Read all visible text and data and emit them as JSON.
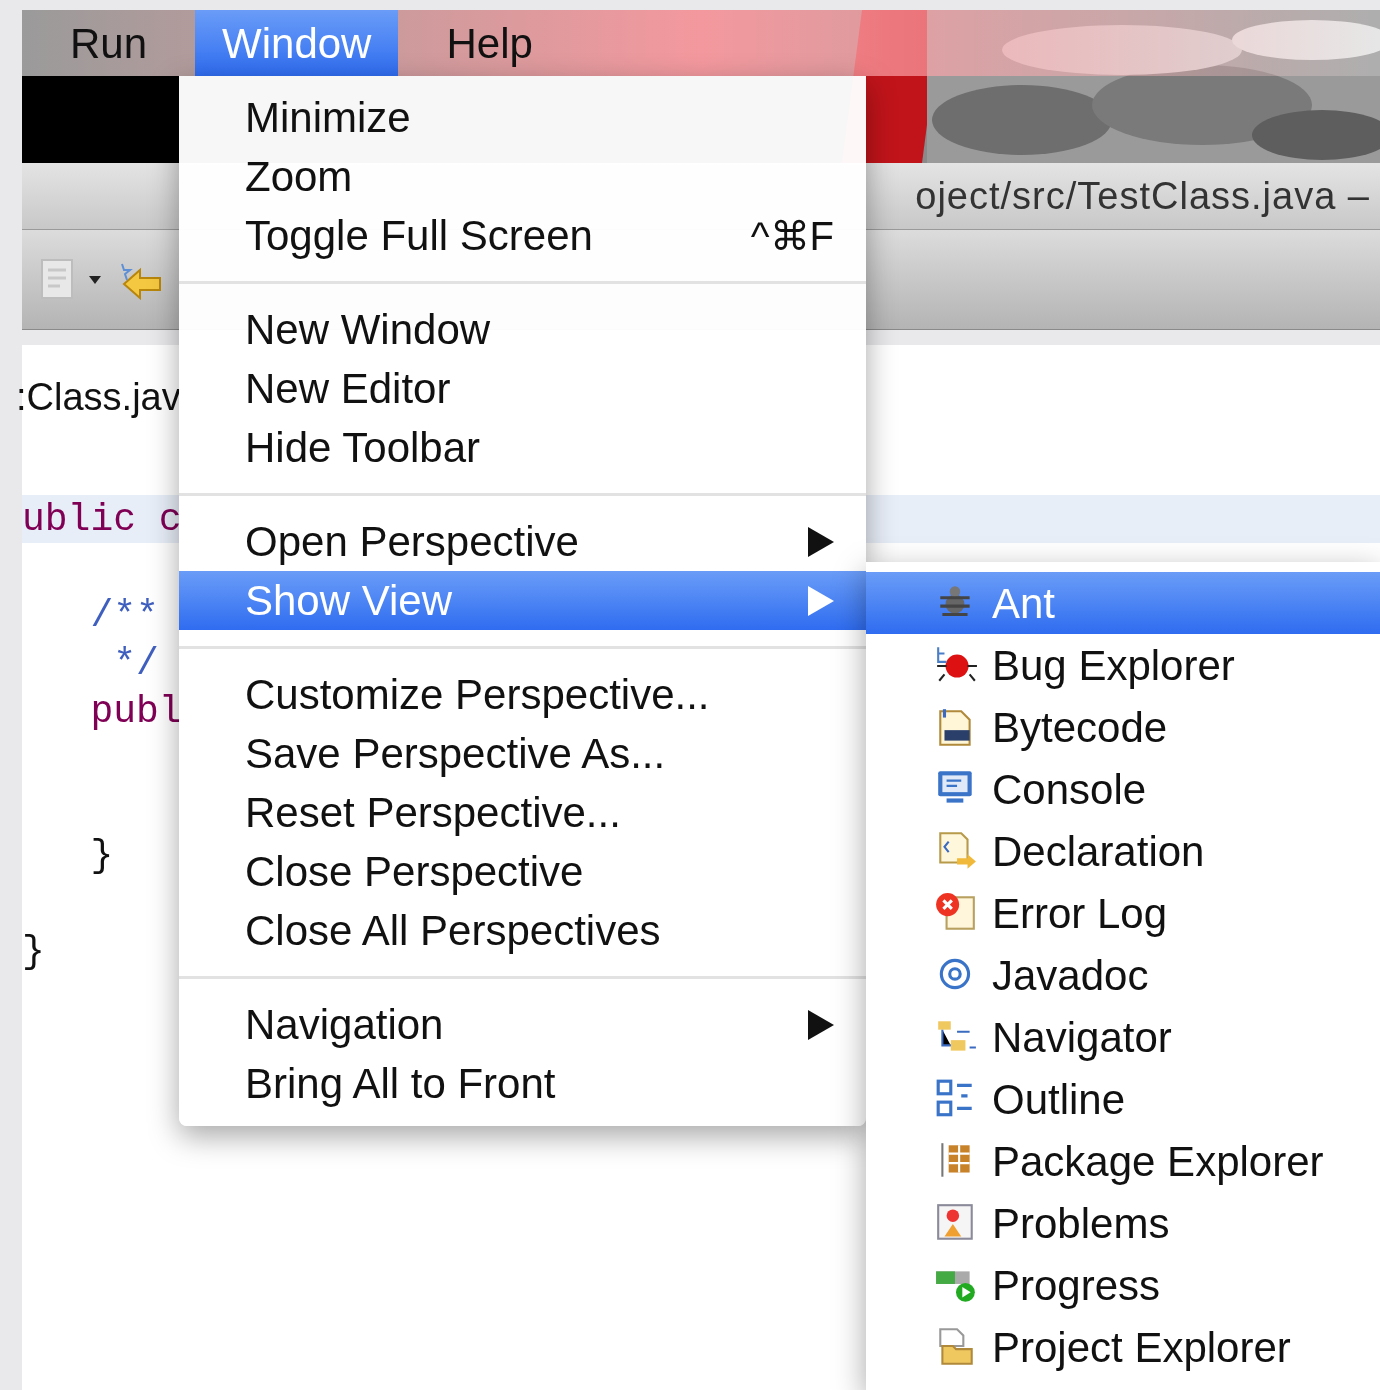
{
  "menu_bar": [
    {
      "label": "Run",
      "selected": false
    },
    {
      "label": "Window",
      "selected": true
    },
    {
      "label": "Help",
      "selected": false
    }
  ],
  "window_title": "oject/src/TestClass.java –",
  "editor_tab": ":Class.jav",
  "code_lines": [
    {
      "text": "ublic c",
      "kind": "keyword",
      "highlighted": true
    },
    {
      "kind": "blank"
    },
    {
      "text": "   /**",
      "kind": "comment",
      "highlighted": false
    },
    {
      "text": "    */",
      "kind": "comment",
      "highlighted": false
    },
    {
      "text": "   publ",
      "kind": "keyword",
      "highlighted": false
    },
    {
      "kind": "blank"
    },
    {
      "kind": "blank"
    },
    {
      "text": "   }",
      "kind": "plain",
      "highlighted": false
    },
    {
      "kind": "blank"
    },
    {
      "text": "}",
      "kind": "plain",
      "highlighted": false
    }
  ],
  "window_menu": [
    {
      "kind": "item",
      "label": "Minimize",
      "selected": false
    },
    {
      "kind": "item",
      "label": "Zoom",
      "selected": false
    },
    {
      "kind": "item",
      "label": "Toggle Full Screen",
      "shortcut": "^⌘F",
      "selected": false
    },
    {
      "kind": "separator"
    },
    {
      "kind": "item",
      "label": "New Window",
      "selected": false
    },
    {
      "kind": "item",
      "label": "New Editor",
      "selected": false
    },
    {
      "kind": "item",
      "label": "Hide Toolbar",
      "selected": false
    },
    {
      "kind": "separator"
    },
    {
      "kind": "item",
      "label": "Open Perspective",
      "submenu": true,
      "selected": false
    },
    {
      "kind": "item",
      "label": "Show View",
      "submenu": true,
      "selected": true
    },
    {
      "kind": "separator"
    },
    {
      "kind": "item",
      "label": "Customize Perspective...",
      "selected": false
    },
    {
      "kind": "item",
      "label": "Save Perspective As...",
      "selected": false
    },
    {
      "kind": "item",
      "label": "Reset Perspective...",
      "selected": false
    },
    {
      "kind": "item",
      "label": "Close Perspective",
      "selected": false
    },
    {
      "kind": "item",
      "label": "Close All Perspectives",
      "selected": false
    },
    {
      "kind": "separator"
    },
    {
      "kind": "item",
      "label": "Navigation",
      "submenu": true,
      "selected": false
    },
    {
      "kind": "item",
      "label": "Bring All to Front",
      "selected": false
    }
  ],
  "show_view_submenu": [
    {
      "label": "Ant",
      "selected": true
    },
    {
      "label": "Bug Explorer",
      "selected": false
    },
    {
      "label": "Bytecode",
      "selected": false
    },
    {
      "label": "Console",
      "selected": false
    },
    {
      "label": "Declaration",
      "selected": false
    },
    {
      "label": "Error Log",
      "selected": false
    },
    {
      "label": "Javadoc",
      "selected": false
    },
    {
      "label": "Navigator",
      "selected": false
    },
    {
      "label": "Outline",
      "selected": false
    },
    {
      "label": "Package Explorer",
      "selected": false
    },
    {
      "label": "Problems",
      "selected": false
    },
    {
      "label": "Progress",
      "selected": false
    },
    {
      "label": "Project Explorer",
      "selected": false
    }
  ]
}
